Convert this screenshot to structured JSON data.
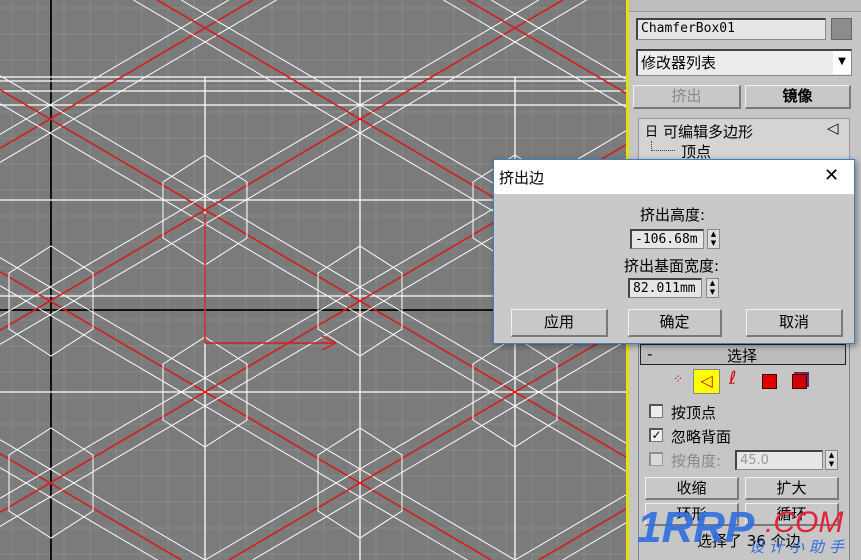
{
  "viewport": {
    "grid_color": "#8a8a8a",
    "wire_color": "#ffffff",
    "selected_color": "#d02020",
    "axis_color": "#111111"
  },
  "panel": {
    "object_name": "ChamferBox01",
    "modifier_list": "修改器列表",
    "buttons": {
      "extrude": "挤出",
      "mirror": "镜像"
    },
    "stack": {
      "root": "可编辑多边形",
      "child": "顶点",
      "minus": "日"
    },
    "selection": {
      "header": "选择",
      "collapse": "-",
      "by_vertex": "按顶点",
      "ignore_backfacing": "忽略背面",
      "by_angle": "按角度:",
      "angle_value": "45.0",
      "shrink": "收缩",
      "grow": "扩大",
      "ring": "环形",
      "loop": "循环",
      "status": "选择了 36 个边",
      "ignore_backfacing_checked": true,
      "by_vertex_checked": false,
      "by_angle_checked": false,
      "active_level": "edge"
    }
  },
  "dialog": {
    "title": "挤出边",
    "close": "✕",
    "height_label": "挤出高度:",
    "height_value": "-106.68m",
    "width_label": "挤出基面宽度:",
    "width_value": "82.011mm",
    "apply": "应用",
    "ok": "确定",
    "cancel": "取消"
  },
  "watermark": {
    "main": "1RRP",
    "suffix": ".COM",
    "sub": "设计小助手"
  }
}
